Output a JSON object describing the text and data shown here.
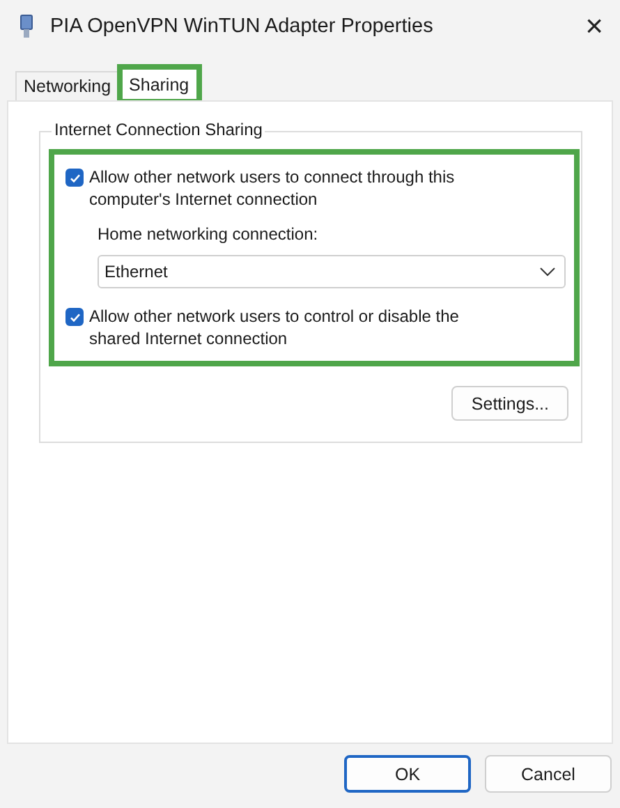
{
  "window": {
    "title": "PIA OpenVPN WinTUN Adapter Properties",
    "close": "×"
  },
  "tabs": [
    {
      "label": "Networking",
      "selected": false,
      "highlighted": false
    },
    {
      "label": "Sharing",
      "selected": true,
      "highlighted": true
    }
  ],
  "group": {
    "title": "Internet Connection Sharing",
    "highlighted": true,
    "options": [
      {
        "label": "Allow other network users to connect through this computer's Internet connection",
        "checked": true
      },
      {
        "label": "Allow other network users to control or disable the shared Internet connection",
        "checked": true
      }
    ],
    "home_connection": {
      "label": "Home networking connection:",
      "value": "Ethernet"
    }
  },
  "settings_button": "Settings...",
  "buttons": [
    {
      "label": "OK",
      "default": true
    },
    {
      "label": "Cancel",
      "default": false
    }
  ]
}
